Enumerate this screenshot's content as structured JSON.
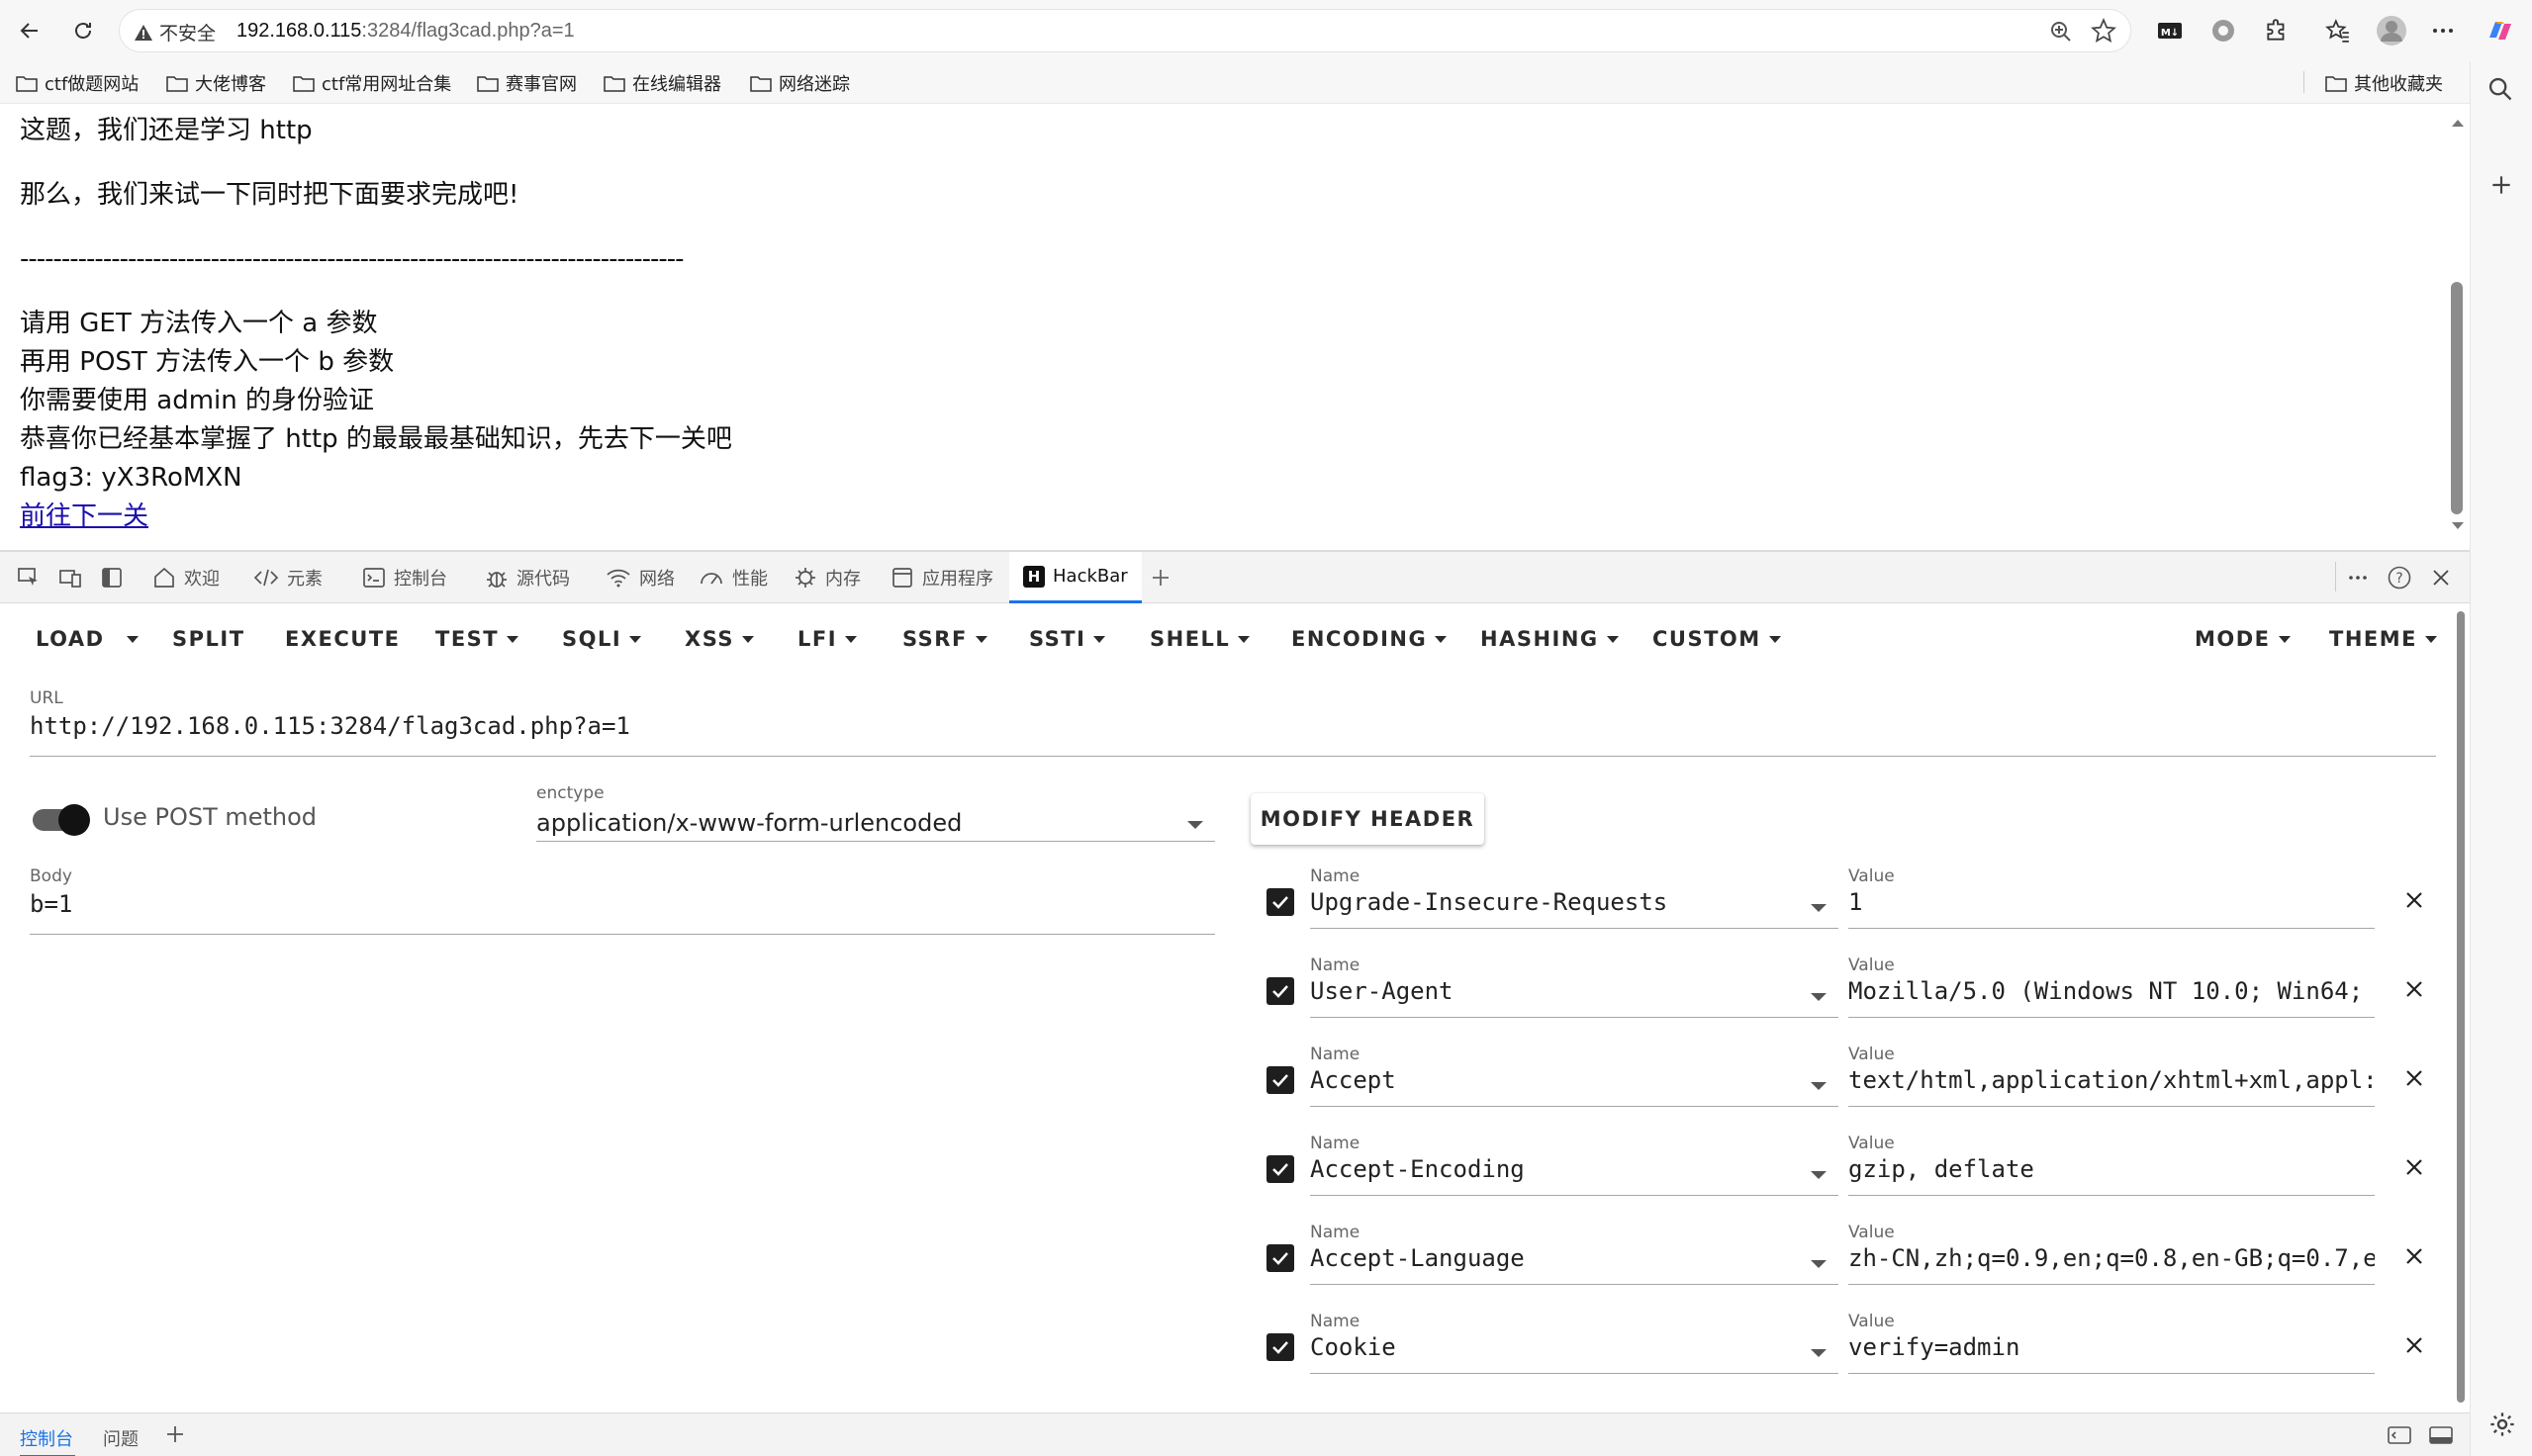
{
  "browser": {
    "security_label": "不安全",
    "url_host": "192.168.0.115",
    "url_rest": ":3284/flag3cad.php?a=1",
    "bookmarks": [
      "ctf做题网站",
      "大佬博客",
      "ctf常用网址合集",
      "赛事官网",
      "在线编辑器",
      "网络迷踪"
    ],
    "other_bookmarks": "其他收藏夹"
  },
  "page": {
    "line1": "这题，我们还是学习 http",
    "line2": "那么，我们来试一下同时把下面要求完成吧!",
    "divider": "--------------------------------------------------------------------------------",
    "req1": "请用 GET 方法传入一个 a 参数",
    "req2": "再用 POST 方法传入一个 b 参数",
    "req3": "你需要使用 admin 的身份验证",
    "req4": "恭喜你已经基本掌握了 http 的最最最基础知识，先去下一关吧",
    "flag": "flag3: yX3RoMXN",
    "next_link": "前往下一关"
  },
  "devtools": {
    "tabs": [
      "欢迎",
      "元素",
      "控制台",
      "源代码",
      "网络",
      "性能",
      "内存",
      "应用程序"
    ],
    "active_tab": "HackBar",
    "drawer_tabs": [
      "控制台",
      "问题"
    ]
  },
  "hackbar": {
    "toolbar": {
      "load": "LOAD",
      "split": "SPLIT",
      "execute": "EXECUTE",
      "test": "TEST",
      "sqli": "SQLI",
      "xss": "XSS",
      "lfi": "LFI",
      "ssrf": "SSRF",
      "ssti": "SSTI",
      "shell": "SHELL",
      "encoding": "ENCODING",
      "hashing": "HASHING",
      "custom": "CUSTOM",
      "mode": "MODE",
      "theme": "THEME"
    },
    "url_label": "URL",
    "url_value": "http://192.168.0.115:3284/flag3cad.php?a=1",
    "post_label": "Use POST method",
    "post_enabled": true,
    "enctype_label": "enctype",
    "enctype_value": "application/x-www-form-urlencoded",
    "body_label": "Body",
    "body_value": "b=1",
    "modify_header": "MODIFY HEADER",
    "name_label": "Name",
    "value_label": "Value",
    "headers": [
      {
        "name": "Upgrade-Insecure-Requests",
        "value": "1",
        "enabled": true
      },
      {
        "name": "User-Agent",
        "value": "Mozilla/5.0 (Windows NT 10.0; Win64;",
        "enabled": true
      },
      {
        "name": "Accept",
        "value": "text/html,application/xhtml+xml,appl:",
        "enabled": true
      },
      {
        "name": "Accept-Encoding",
        "value": "gzip, deflate",
        "enabled": true
      },
      {
        "name": "Accept-Language",
        "value": "zh-CN,zh;q=0.9,en;q=0.8,en-GB;q=0.7,e",
        "enabled": true
      },
      {
        "name": "Cookie",
        "value": "verify=admin",
        "enabled": true
      }
    ]
  },
  "colors": {
    "link": "#1a0dab",
    "accent": "#1a73e8",
    "chrome_bg": "#f7f7f7",
    "devtools_bg": "#f3f3f3"
  }
}
